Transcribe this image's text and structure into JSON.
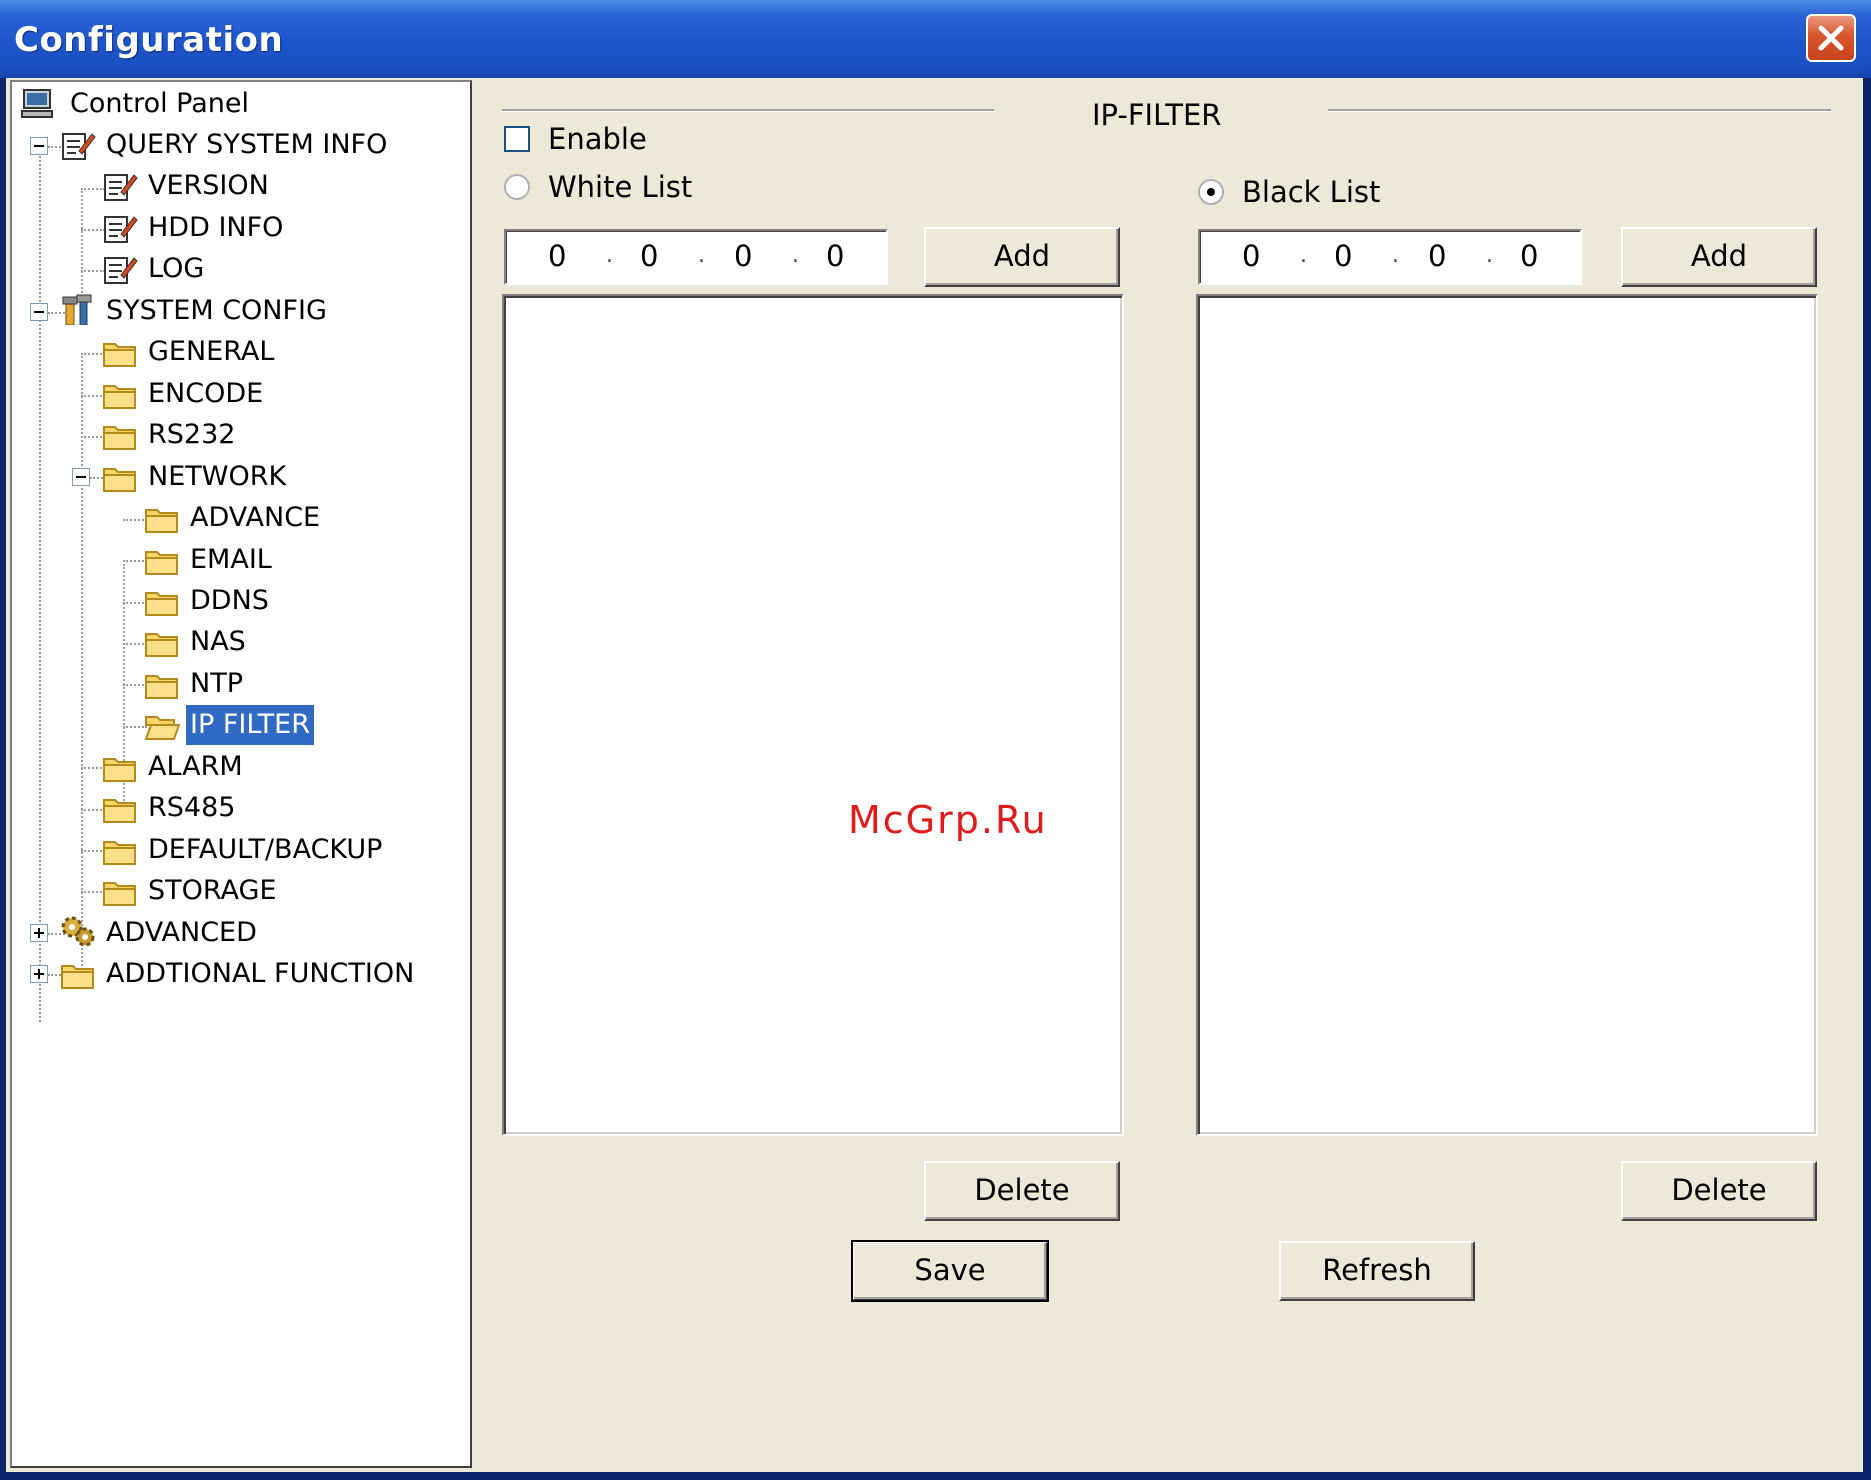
{
  "window": {
    "title": "Configuration",
    "close_icon": "close-icon"
  },
  "tree": {
    "items": [
      {
        "label": "Control Panel",
        "icon": "computer-icon"
      },
      {
        "label": "QUERY SYSTEM INFO",
        "icon": "notepad-icon",
        "expanded": true
      },
      {
        "label": "VERSION",
        "icon": "notepad-icon"
      },
      {
        "label": "HDD INFO",
        "icon": "notepad-icon"
      },
      {
        "label": "LOG",
        "icon": "notepad-icon"
      },
      {
        "label": "SYSTEM CONFIG",
        "icon": "tools-icon",
        "expanded": true
      },
      {
        "label": "GENERAL",
        "icon": "folder-icon"
      },
      {
        "label": "ENCODE",
        "icon": "folder-icon"
      },
      {
        "label": "RS232",
        "icon": "folder-icon"
      },
      {
        "label": "NETWORK",
        "icon": "folder-icon",
        "expanded": true
      },
      {
        "label": "ADVANCE",
        "icon": "folder-icon"
      },
      {
        "label": "EMAIL",
        "icon": "folder-icon"
      },
      {
        "label": "DDNS",
        "icon": "folder-icon"
      },
      {
        "label": "NAS",
        "icon": "folder-icon"
      },
      {
        "label": "NTP",
        "icon": "folder-icon"
      },
      {
        "label": "IP FILTER",
        "icon": "open-folder-icon",
        "selected": true
      },
      {
        "label": "ALARM",
        "icon": "folder-icon"
      },
      {
        "label": "RS485",
        "icon": "folder-icon"
      },
      {
        "label": "DEFAULT/BACKUP",
        "icon": "folder-icon"
      },
      {
        "label": "STORAGE",
        "icon": "folder-icon"
      },
      {
        "label": "ADVANCED",
        "icon": "gears-icon",
        "expanded": false
      },
      {
        "label": "ADDTIONAL FUNCTION",
        "icon": "folder-icon",
        "expanded": false
      }
    ]
  },
  "ipfilter": {
    "group_title": "IP-FILTER",
    "enable_label": "Enable",
    "enable_checked": false,
    "white_list_label": "White List",
    "black_list_label": "Black List",
    "selected_list": "Black List",
    "white_ip": [
      "0",
      "0",
      "0",
      "0"
    ],
    "black_ip": [
      "0",
      "0",
      "0",
      "0"
    ],
    "add_label": "Add",
    "delete_label": "Delete",
    "white_entries": [],
    "black_entries": []
  },
  "footer": {
    "save_label": "Save",
    "refresh_label": "Refresh"
  },
  "watermark": "McGrp.Ru"
}
